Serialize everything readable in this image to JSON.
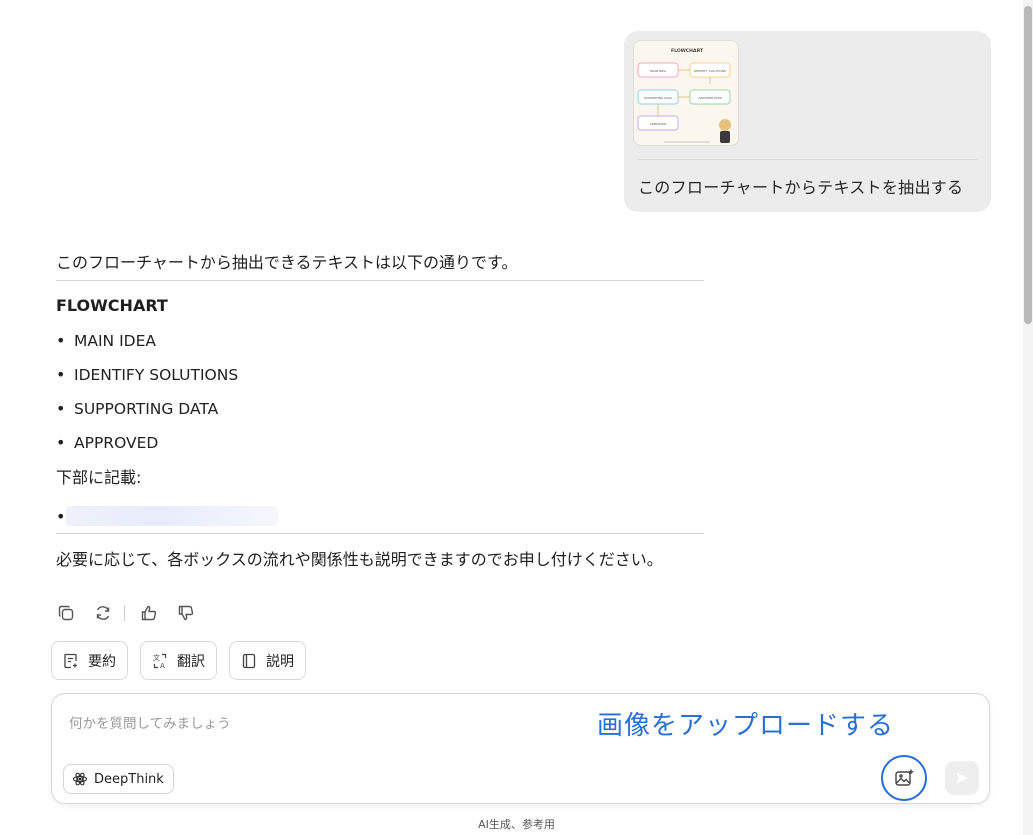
{
  "user_message": {
    "text": "このフローチャートからテキストを抽出する",
    "thumbnail": {
      "title": "FLOWCHART",
      "boxes": [
        "MAIN IDEA",
        "IDENTIFY SOLUTIONS",
        "SUPPORTING DATA",
        "ANOTHER STEP",
        "APPROVED"
      ]
    }
  },
  "answer": {
    "intro": "このフローチャートから抽出できるテキストは以下の通りです。",
    "section_title": "FLOWCHART",
    "items": [
      "MAIN IDEA",
      "IDENTIFY SOLUTIONS",
      "SUPPORTING DATA",
      "APPROVED"
    ],
    "bottom_note": "下部に記載:",
    "bullet": "•",
    "closing": "必要に応じて、各ボックスの流れや関係性も説明できますのでお申し付けください。"
  },
  "action_icons": [
    "copy-icon",
    "regenerate-icon",
    "thumbs-up-icon",
    "thumbs-down-icon"
  ],
  "chips": [
    {
      "label": "要約",
      "icon": "summary-icon"
    },
    {
      "label": "翻訳",
      "icon": "translate-icon"
    },
    {
      "label": "説明",
      "icon": "book-icon"
    }
  ],
  "input": {
    "placeholder": "何かを質問してみましょう",
    "deepthink_label": "DeepThink",
    "upload_annotation": "画像をアップロードする"
  },
  "footer": "AI生成、参考用",
  "colors": {
    "annotation": "#2a6fd6",
    "bubble": "#ececec"
  }
}
